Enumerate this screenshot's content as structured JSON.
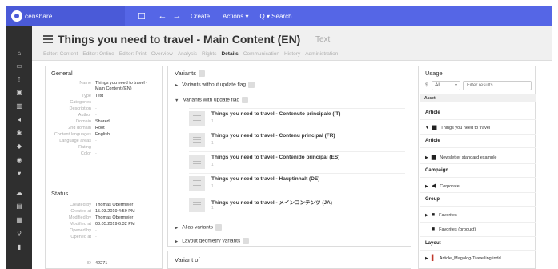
{
  "topbar": {
    "logo_text": "censhare",
    "create_label": "Create",
    "actions_label": "Actions ▾",
    "search_label": "Q ▾ Search"
  },
  "header": {
    "title": "Things you need to travel - Main Content (EN)",
    "type_label": "Text",
    "tabs": [
      "Editor: Content",
      "Editor: Online",
      "Editor: Print",
      "Overview",
      "Analysis",
      "Rights",
      "Details",
      "Communication",
      "History",
      "Administration"
    ],
    "active_tab": "Details"
  },
  "general": {
    "title": "General",
    "fields": [
      {
        "key": "Name",
        "value": "Things you need to travel - Main Content (EN)"
      },
      {
        "key": "Type",
        "value": "Text"
      },
      {
        "key": "Categories",
        "value": "-"
      },
      {
        "key": "Description",
        "value": "-"
      },
      {
        "key": "Author",
        "value": "-"
      },
      {
        "key": "Domain",
        "value": "Shared"
      },
      {
        "key": "2nd domain",
        "value": "Root"
      },
      {
        "key": "Content languages",
        "value": "English"
      },
      {
        "key": "Language areas",
        "value": "-"
      },
      {
        "key": "Rating",
        "value": "-"
      },
      {
        "key": "Color",
        "value": "-"
      }
    ],
    "status_title": "Status",
    "status_fields": [
      {
        "key": "Created by",
        "value": "Thomas Obermeier"
      },
      {
        "key": "Created at",
        "value": "15.03.2019 4:59 PM"
      },
      {
        "key": "Modified by",
        "value": "Thomas Obermeier"
      },
      {
        "key": "Modified at",
        "value": "03.05.2019 6:32 PM"
      },
      {
        "key": "Opened by",
        "value": "-"
      },
      {
        "key": "Opened at",
        "value": "-"
      }
    ],
    "id_key": "ID",
    "id_value": "42271"
  },
  "variants": {
    "title": "Variants",
    "without_flag": "Variants without update flag",
    "with_flag": "Variants with update flag",
    "items": [
      {
        "name": "Things you need to travel - Contenuto principale (IT)",
        "sub": "1"
      },
      {
        "name": "Things you need to travel - Contenu principal (FR)",
        "sub": "1"
      },
      {
        "name": "Things you need to travel - Contenido principal (ES)",
        "sub": "1"
      },
      {
        "name": "Things you need to travel - Hauptinhalt (DE)",
        "sub": "1"
      },
      {
        "name": "Things you need to travel - メインコンテンツ (JA)",
        "sub": "1"
      }
    ],
    "alias": "Alias variants",
    "layout": "Layout geometry variants"
  },
  "variant_of": {
    "title": "Variant of"
  },
  "usage": {
    "title": "Usage",
    "dollar": "$",
    "select_value": "All",
    "filter_placeholder": "Filter results",
    "column_head": "Asset",
    "groups": {
      "article": "Article",
      "article2": "Article",
      "campaign": "Campaign",
      "group": "Group",
      "layout": "Layout"
    },
    "items": {
      "things": "Things you need to travel",
      "newsletter": "Newsletter standard example",
      "corporate": "Corporate",
      "favorites": "Favorites",
      "favorites_product": "Favorites (product)",
      "indd": "Article_Magalog-Travelling.indd"
    }
  }
}
